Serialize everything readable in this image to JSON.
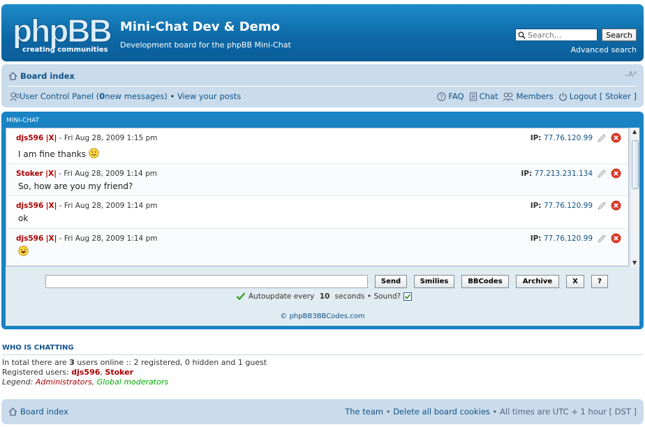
{
  "header": {
    "logo_word": "phpBB",
    "logo_tagline": "creating  communities",
    "site_title": "Mini-Chat Dev & Demo",
    "site_description": "Development board for the phpBB Mini-Chat",
    "search_placeholder": "Search…",
    "search_button": "Search",
    "advanced_search": "Advanced search"
  },
  "navbar": {
    "board_index": "Board index",
    "font_size": "ᵥAᴬ",
    "ucp_prefix": "User Control Panel (",
    "new_messages_count": "0",
    "ucp_suffix": " new messages)",
    "bullet": " • ",
    "view_posts": "View your posts",
    "faq": "FAQ",
    "chat": "Chat",
    "members": "Members",
    "logout": "Logout [ Stoker ]"
  },
  "minichat": {
    "title": "MINI-CHAT",
    "messages": [
      {
        "user": "djs596",
        "kick": "|X|",
        "time": " - Fri Aug 28, 2009 1:15 pm",
        "text": "I am fine thanks",
        "smiley": "smile",
        "ip_label": "IP:",
        "ip": "77.76.120.99"
      },
      {
        "user": "Stoker",
        "kick": "|X|",
        "time": " - Fri Aug 28, 2009 1:14 pm",
        "text": "So, how are you my friend?",
        "smiley": "",
        "ip_label": "IP:",
        "ip": "77.213.231.134"
      },
      {
        "user": "djs596",
        "kick": "|X|",
        "time": " - Fri Aug 28, 2009 1:14 pm",
        "text": "ok",
        "smiley": "",
        "ip_label": "IP:",
        "ip": "77.76.120.99"
      },
      {
        "user": "djs596",
        "kick": "|X|",
        "time": " - Fri Aug 28, 2009 1:14 pm",
        "text": "",
        "smiley": "laugh",
        "ip_label": "IP:",
        "ip": "77.76.120.99"
      }
    ],
    "buttons": {
      "send": "Send",
      "smilies": "Smilies",
      "bbcodes": "BBCodes",
      "archive": "Archive",
      "close": "X",
      "help": "?"
    },
    "autoupdate_prefix": "Autoupdate every ",
    "autoupdate_seconds": "10",
    "autoupdate_suffix": " seconds • Sound?",
    "sound_enabled": true,
    "copyright": "© phpBB3BBCodes.com"
  },
  "who_is_chatting": {
    "title": "WHO IS CHATTING",
    "summary_prefix": "In total there are ",
    "summary_count": "3",
    "summary_suffix": " users online :: 2 registered, 0 hidden and 1 guest",
    "registered_label": "Registered users: ",
    "users": [
      "djs596",
      "Stoker"
    ],
    "separator": ", ",
    "legend_label": "Legend: ",
    "legend_admins": "Administrators",
    "legend_mods": "Global moderators"
  },
  "footer": {
    "board_index": "Board index",
    "the_team": "The team",
    "delete_cookies": "Delete all board cookies",
    "times": "All times are UTC + 1 hour [ DST ]",
    "bullet": " • "
  },
  "colors": {
    "header_blue": "#1a83c4",
    "nav_bg": "#cadceb",
    "link": "#105289",
    "admin_red": "#aa0000",
    "mod_green": "#00aa00"
  }
}
